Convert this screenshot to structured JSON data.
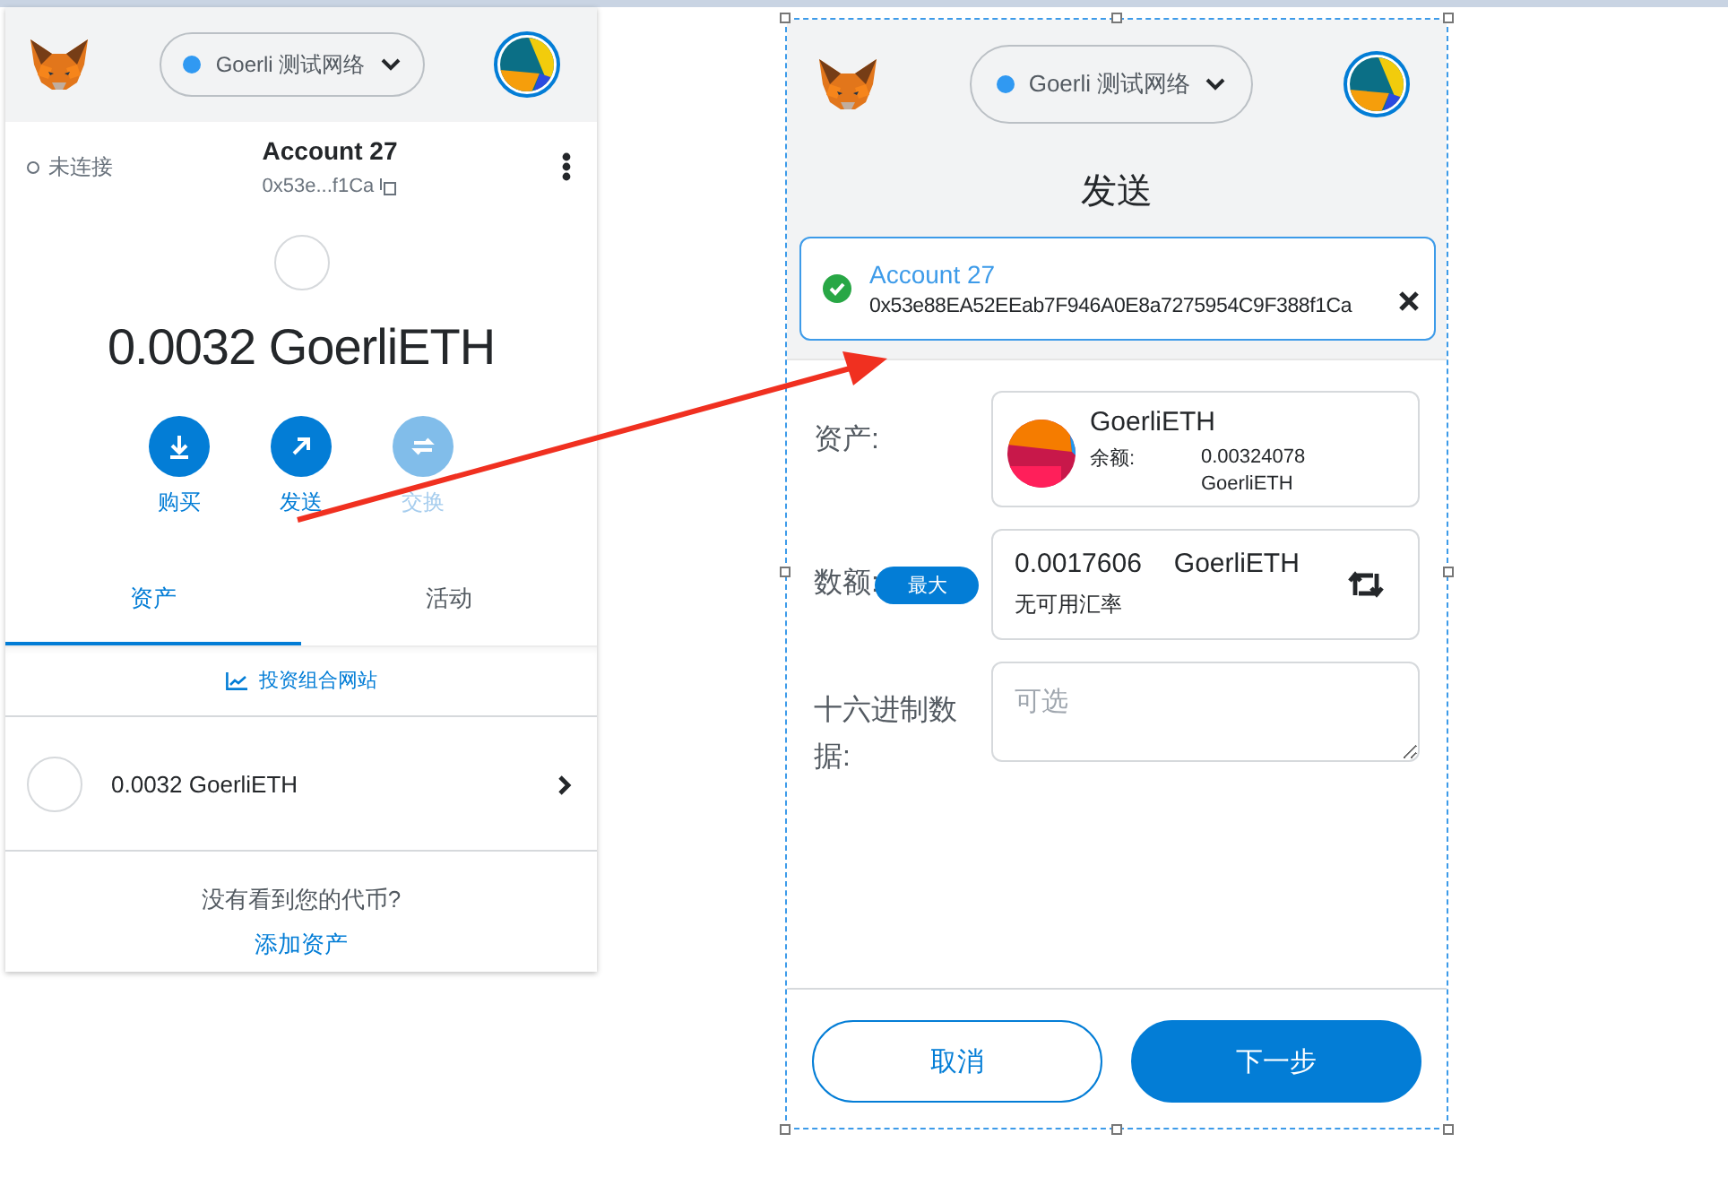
{
  "wallet": {
    "network": "Goerli 测试网络",
    "connection_status": "未连接",
    "account_name": "Account 27",
    "address": "0x53e...f1Ca",
    "balance": "0.0032 GoerliETH",
    "actions": [
      {
        "label": "购买",
        "kind": "buy",
        "disabled": false
      },
      {
        "label": "发送",
        "kind": "send",
        "disabled": false
      },
      {
        "label": "交换",
        "kind": "swap",
        "disabled": true
      }
    ],
    "tabs": [
      {
        "label": "资产",
        "selected": true
      },
      {
        "label": "活动",
        "selected": false
      }
    ],
    "portfolio_link": "投资组合网站",
    "assets": [
      {
        "label": "0.0032 GoerliETH"
      }
    ],
    "help_text": "没有看到您的代币?",
    "add_asset_link": "添加资产"
  },
  "send": {
    "network": "Goerli 测试网络",
    "title": "发送",
    "recipient": {
      "name": "Account 27",
      "address": "0x53e88EA52EEab7F946A0E8a7275954C9F388f1Ca",
      "verified": true
    },
    "asset": {
      "label": "资产:",
      "name": "GoerliETH",
      "balance_label": "余额:",
      "balance_value": "0.00324078 GoerliETH"
    },
    "amount": {
      "label": "数额:",
      "max_button": "最大",
      "value": "0.0017606",
      "unit": "GoerliETH",
      "rate_note": "无可用汇率"
    },
    "hex_data": {
      "label": "十六进制数据:",
      "placeholder": "可选"
    },
    "buttons": [
      {
        "label": "取消",
        "kind": "secondary"
      },
      {
        "label": "下一步",
        "kind": "primary"
      }
    ]
  }
}
